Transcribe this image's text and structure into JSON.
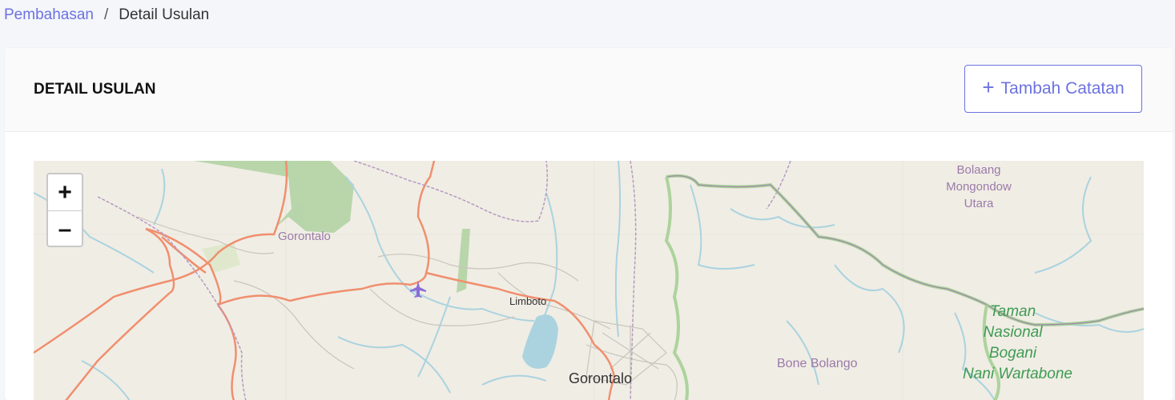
{
  "breadcrumb": {
    "parent": "Pembahasan",
    "separator": "/",
    "current": "Detail Usulan"
  },
  "card": {
    "title": "DETAIL USULAN",
    "add_button_label": "Tambah Catatan",
    "add_button_icon": "plus-icon"
  },
  "map": {
    "zoom_in": "+",
    "zoom_out": "–",
    "labels": {
      "gorontalo_region": "Gorontalo",
      "limboto": "Limboto",
      "gorontalo_city": "Gorontalo",
      "bone_bolango": "Bone Bolango",
      "bolaang_line1": "Bolaang",
      "bolaang_line2": "Mongondow",
      "bolaang_line3": "Utara",
      "park_line1": "Taman",
      "park_line2": "Nasional",
      "park_line3": "Bogani",
      "park_line4": "Nani Wartabone"
    },
    "colors": {
      "land": "#f0ede5",
      "road": "#f08f6e",
      "water": "#aad3df",
      "forest": "#aed1a0",
      "boundary": "#a886b5",
      "park_boundary": "#98c78a"
    }
  }
}
